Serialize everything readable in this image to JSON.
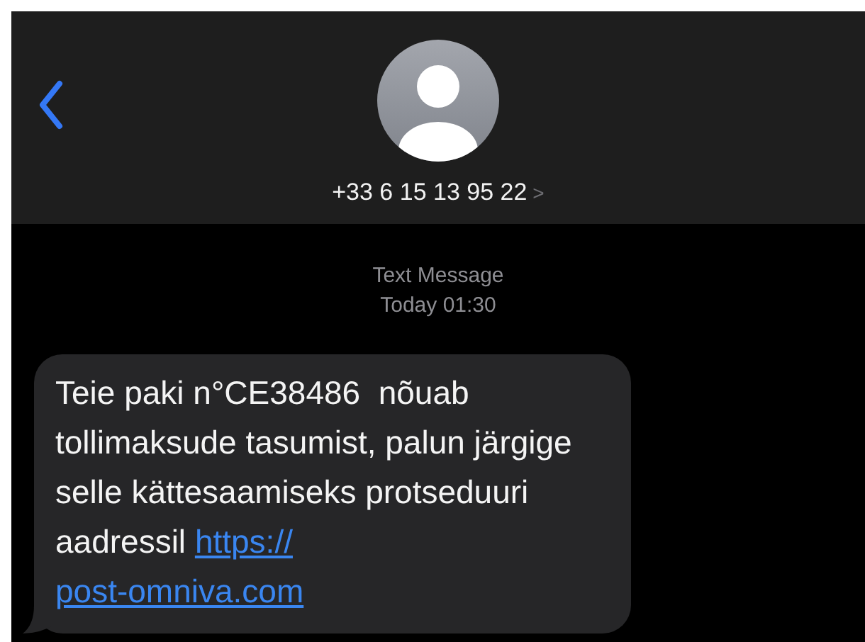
{
  "header": {
    "contact": "+33 6 15 13 95 22",
    "chevron": ">"
  },
  "thread": {
    "service": "Text Message",
    "time": "Today 01:30"
  },
  "message": {
    "text": "Teie paki n°CE38486  nõuab tollimaksude tasumist, palun järgige selle kättesaamiseks protseduuri aadressil",
    "link_parts": [
      "https://",
      "post-omniva.com"
    ]
  }
}
